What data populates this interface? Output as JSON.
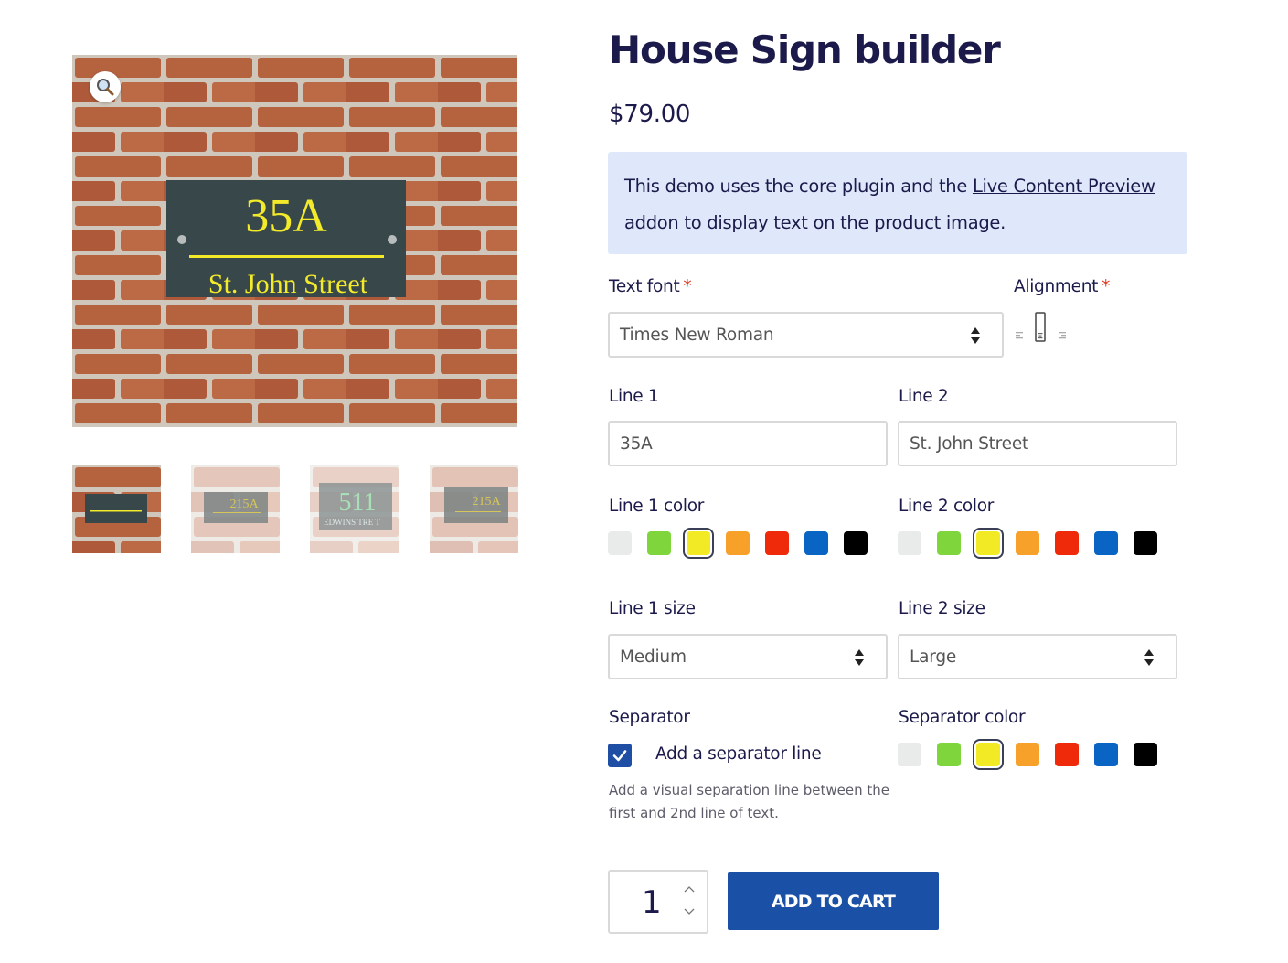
{
  "product": {
    "title": "House Sign builder",
    "price": "$79.00"
  },
  "notice": {
    "text_before": "This demo uses the core plugin and the ",
    "link_text": "Live Content Preview",
    "text_after": " addon to display text on the product image."
  },
  "gallery": {
    "main_sign_line1": "35A",
    "main_sign_line2": "St. John Street",
    "zoom_icon": "magnifier-icon",
    "thumbnails": [
      {
        "line1": "",
        "line2": ""
      },
      {
        "line1": "215A",
        "line2": ""
      },
      {
        "line1": "511",
        "line2": "EDWINS TRE T"
      },
      {
        "line1": "215A",
        "line2": ""
      }
    ]
  },
  "form": {
    "text_font": {
      "label": "Text font",
      "required_mark": "*",
      "value": "Times New Roman"
    },
    "alignment": {
      "label": "Alignment",
      "required_mark": "*",
      "options": [
        "align-left-icon",
        "align-center-icon",
        "align-right-icon"
      ],
      "selected": "align-center-icon"
    },
    "line1": {
      "label": "Line 1",
      "value": "35A"
    },
    "line2": {
      "label": "Line 2",
      "value": "St. John Street"
    },
    "line1_color": {
      "label": "Line 1 color"
    },
    "line2_color": {
      "label": "Line 2 color"
    },
    "line1_size": {
      "label": "Line 1 size",
      "value": "Medium"
    },
    "line2_size": {
      "label": "Line 2 size",
      "value": "Large"
    },
    "separator": {
      "label": "Separator",
      "checkbox_label": "Add a separator line",
      "checked": true,
      "help": "Add a visual separation line between the first and 2nd line of text."
    },
    "separator_color": {
      "label": "Separator color"
    },
    "swatch_colors": [
      "#e9eaea",
      "#7ed63c",
      "#f2ea25",
      "#f7a12b",
      "#ee2a0b",
      "#0a64c3",
      "#000000"
    ],
    "selected_color": "#f2ea25"
  },
  "cart": {
    "quantity": "1",
    "button_label": "ADD TO CART"
  }
}
